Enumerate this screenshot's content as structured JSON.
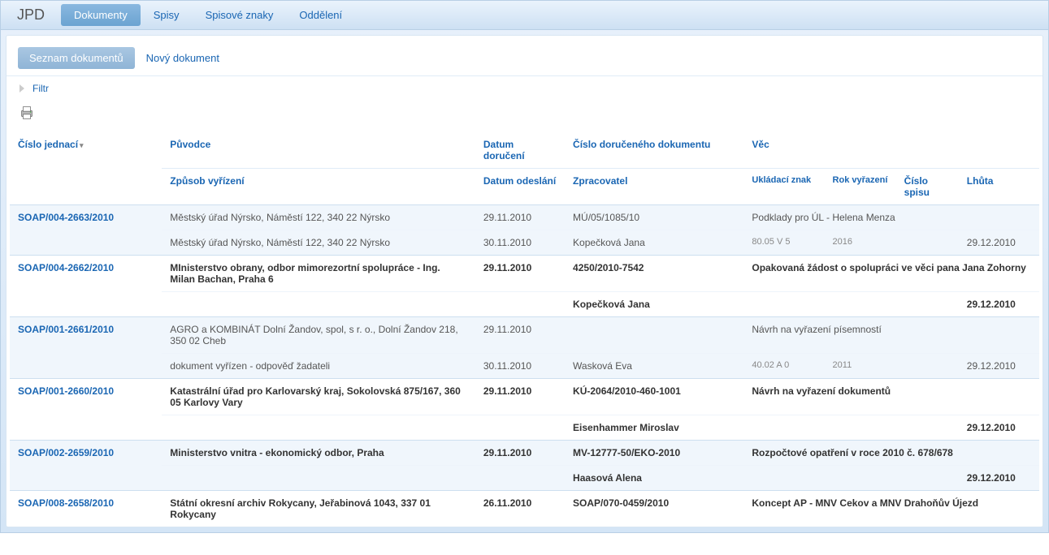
{
  "app": {
    "title": "JPD"
  },
  "nav": {
    "items": [
      {
        "label": "Dokumenty",
        "active": true
      },
      {
        "label": "Spisy",
        "active": false
      },
      {
        "label": "Spisové znaky",
        "active": false
      },
      {
        "label": "Oddělení",
        "active": false
      }
    ]
  },
  "subnav": {
    "items": [
      {
        "label": "Seznam dokumentů",
        "active": true
      },
      {
        "label": "Nový dokument",
        "active": false
      }
    ]
  },
  "filter": {
    "label": "Filtr"
  },
  "headers": {
    "cislo_jednaci": "Číslo jednací",
    "puvodce": "Původce",
    "datum_doruceni": "Datum doručení",
    "cislo_doruceneho": "Číslo doručeného dokumentu",
    "vec": "Věc",
    "zpusob_vyrizeni": "Způsob vyřízení",
    "datum_odeslani": "Datum odeslání",
    "zpracovatel": "Zpracovatel",
    "ukladaci_znak": "Ukládací znak",
    "rok_vyrazeni": "Rok vyřazení",
    "cislo_spisu": "Číslo spisu",
    "lhuta": "Lhůta"
  },
  "rows": [
    {
      "bold": false,
      "cj": "SOAP/004-2663/2010",
      "r1": {
        "puvodce": "Městský úřad Nýrsko, Náměstí 122, 340 22 Nýrsko",
        "datum": "29.11.2010",
        "cdd": "MÚ/05/1085/10",
        "vec": "Podklady pro ÚL - Helena Menza"
      },
      "r2": {
        "zpusob": "Městský úřad Nýrsko, Náměstí 122, 340 22 Nýrsko",
        "datum": "30.11.2010",
        "zprac": "Kopečková Jana",
        "uz": "80.05 V 5",
        "rv": "2016",
        "cs": "",
        "lhuta": "29.12.2010"
      }
    },
    {
      "bold": true,
      "cj": "SOAP/004-2662/2010",
      "r1": {
        "puvodce": "MInisterstvo obrany, odbor mimorezortní spolupráce - Ing. Milan Bachan, Praha 6",
        "datum": "29.11.2010",
        "cdd": "4250/2010-7542",
        "vec": "Opakovaná žádost o spolupráci ve věci pana Jana Zohorny"
      },
      "r2": {
        "zpusob": "",
        "datum": "",
        "zprac": "Kopečková Jana",
        "uz": "",
        "rv": "",
        "cs": "",
        "lhuta": "29.12.2010"
      }
    },
    {
      "bold": false,
      "cj": "SOAP/001-2661/2010",
      "r1": {
        "puvodce": "AGRO a KOMBINÁT Dolní Žandov, spol, s r. o., Dolní Žandov 218, 350 02 Cheb",
        "datum": "29.11.2010",
        "cdd": "",
        "vec": "Návrh na vyřazení písemností"
      },
      "r2": {
        "zpusob": "dokument vyřízen - odpověď žadateli",
        "datum": "30.11.2010",
        "zprac": "Wasková Eva",
        "uz": "40.02 A 0",
        "rv": "2011",
        "cs": "",
        "lhuta": "29.12.2010"
      }
    },
    {
      "bold": true,
      "cj": "SOAP/001-2660/2010",
      "r1": {
        "puvodce": "Katastrální úřad pro Karlovarský kraj, Sokolovská 875/167, 360 05 Karlovy Vary",
        "datum": "29.11.2010",
        "cdd": "KÚ-2064/2010-460-1001",
        "vec": "Návrh na vyřazení dokumentů"
      },
      "r2": {
        "zpusob": "",
        "datum": "",
        "zprac": "Eisenhammer Miroslav",
        "uz": "",
        "rv": "",
        "cs": "",
        "lhuta": "29.12.2010"
      }
    },
    {
      "bold": true,
      "cj": "SOAP/002-2659/2010",
      "r1": {
        "puvodce": "Ministerstvo vnitra - ekonomický odbor, Praha",
        "datum": "29.11.2010",
        "cdd": "MV-12777-50/EKO-2010",
        "vec": "Rozpočtové opatření v roce 2010 č. 678/678"
      },
      "r2": {
        "zpusob": "",
        "datum": "",
        "zprac": "Haasová Alena",
        "uz": "",
        "rv": "",
        "cs": "",
        "lhuta": "29.12.2010"
      }
    },
    {
      "bold": true,
      "cj": "SOAP/008-2658/2010",
      "r1": {
        "puvodce": "Státní okresní archiv Rokycany, Jeřabinová 1043, 337 01 Rokycany",
        "datum": "26.11.2010",
        "cdd": "SOAP/070-0459/2010",
        "vec": "Koncept AP - MNV Cekov a MNV Drahoňův Újezd"
      },
      "r2": null
    }
  ]
}
